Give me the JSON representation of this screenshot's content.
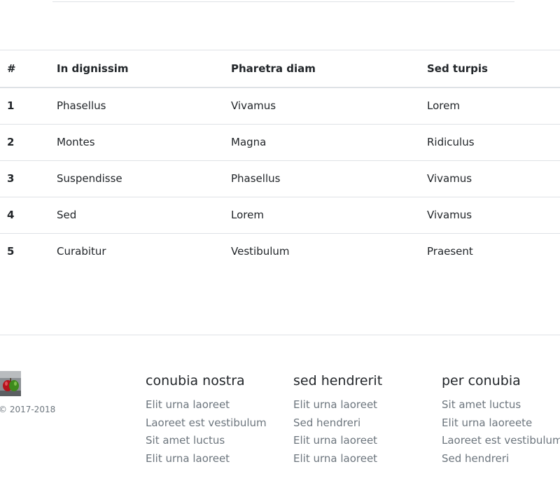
{
  "table": {
    "headers": [
      "#",
      "In dignissim",
      "Pharetra diam",
      "Sed turpis"
    ],
    "rows": [
      [
        "1",
        "Phasellus",
        "Vivamus",
        "Lorem"
      ],
      [
        "2",
        "Montes",
        "Magna",
        "Ridiculus"
      ],
      [
        "3",
        "Suspendisse",
        "Phasellus",
        "Vivamus"
      ],
      [
        "4",
        "Sed",
        "Lorem",
        "Vivamus"
      ],
      [
        "5",
        "Curabitur",
        "Vestibulum",
        "Praesent"
      ]
    ]
  },
  "footer": {
    "logo_icon": "apple-logo-icon",
    "copyright": "© 2017-2018",
    "columns": [
      {
        "title": "conubia nostra",
        "links": [
          "Elit urna laoreet",
          "Laoreet est vestibulum",
          "Sit amet luctus",
          "Elit urna laoreet"
        ]
      },
      {
        "title": "sed hendrerit",
        "links": [
          "Elit urna laoreet",
          "Sed hendreri",
          "Elit urna laoreet",
          "Elit urna laoreet"
        ]
      },
      {
        "title": "per conubia",
        "links": [
          "Sit amet luctus",
          "Elit urna laoreete",
          "Laoreet est vestibulum",
          "Sed hendreri"
        ]
      }
    ]
  }
}
